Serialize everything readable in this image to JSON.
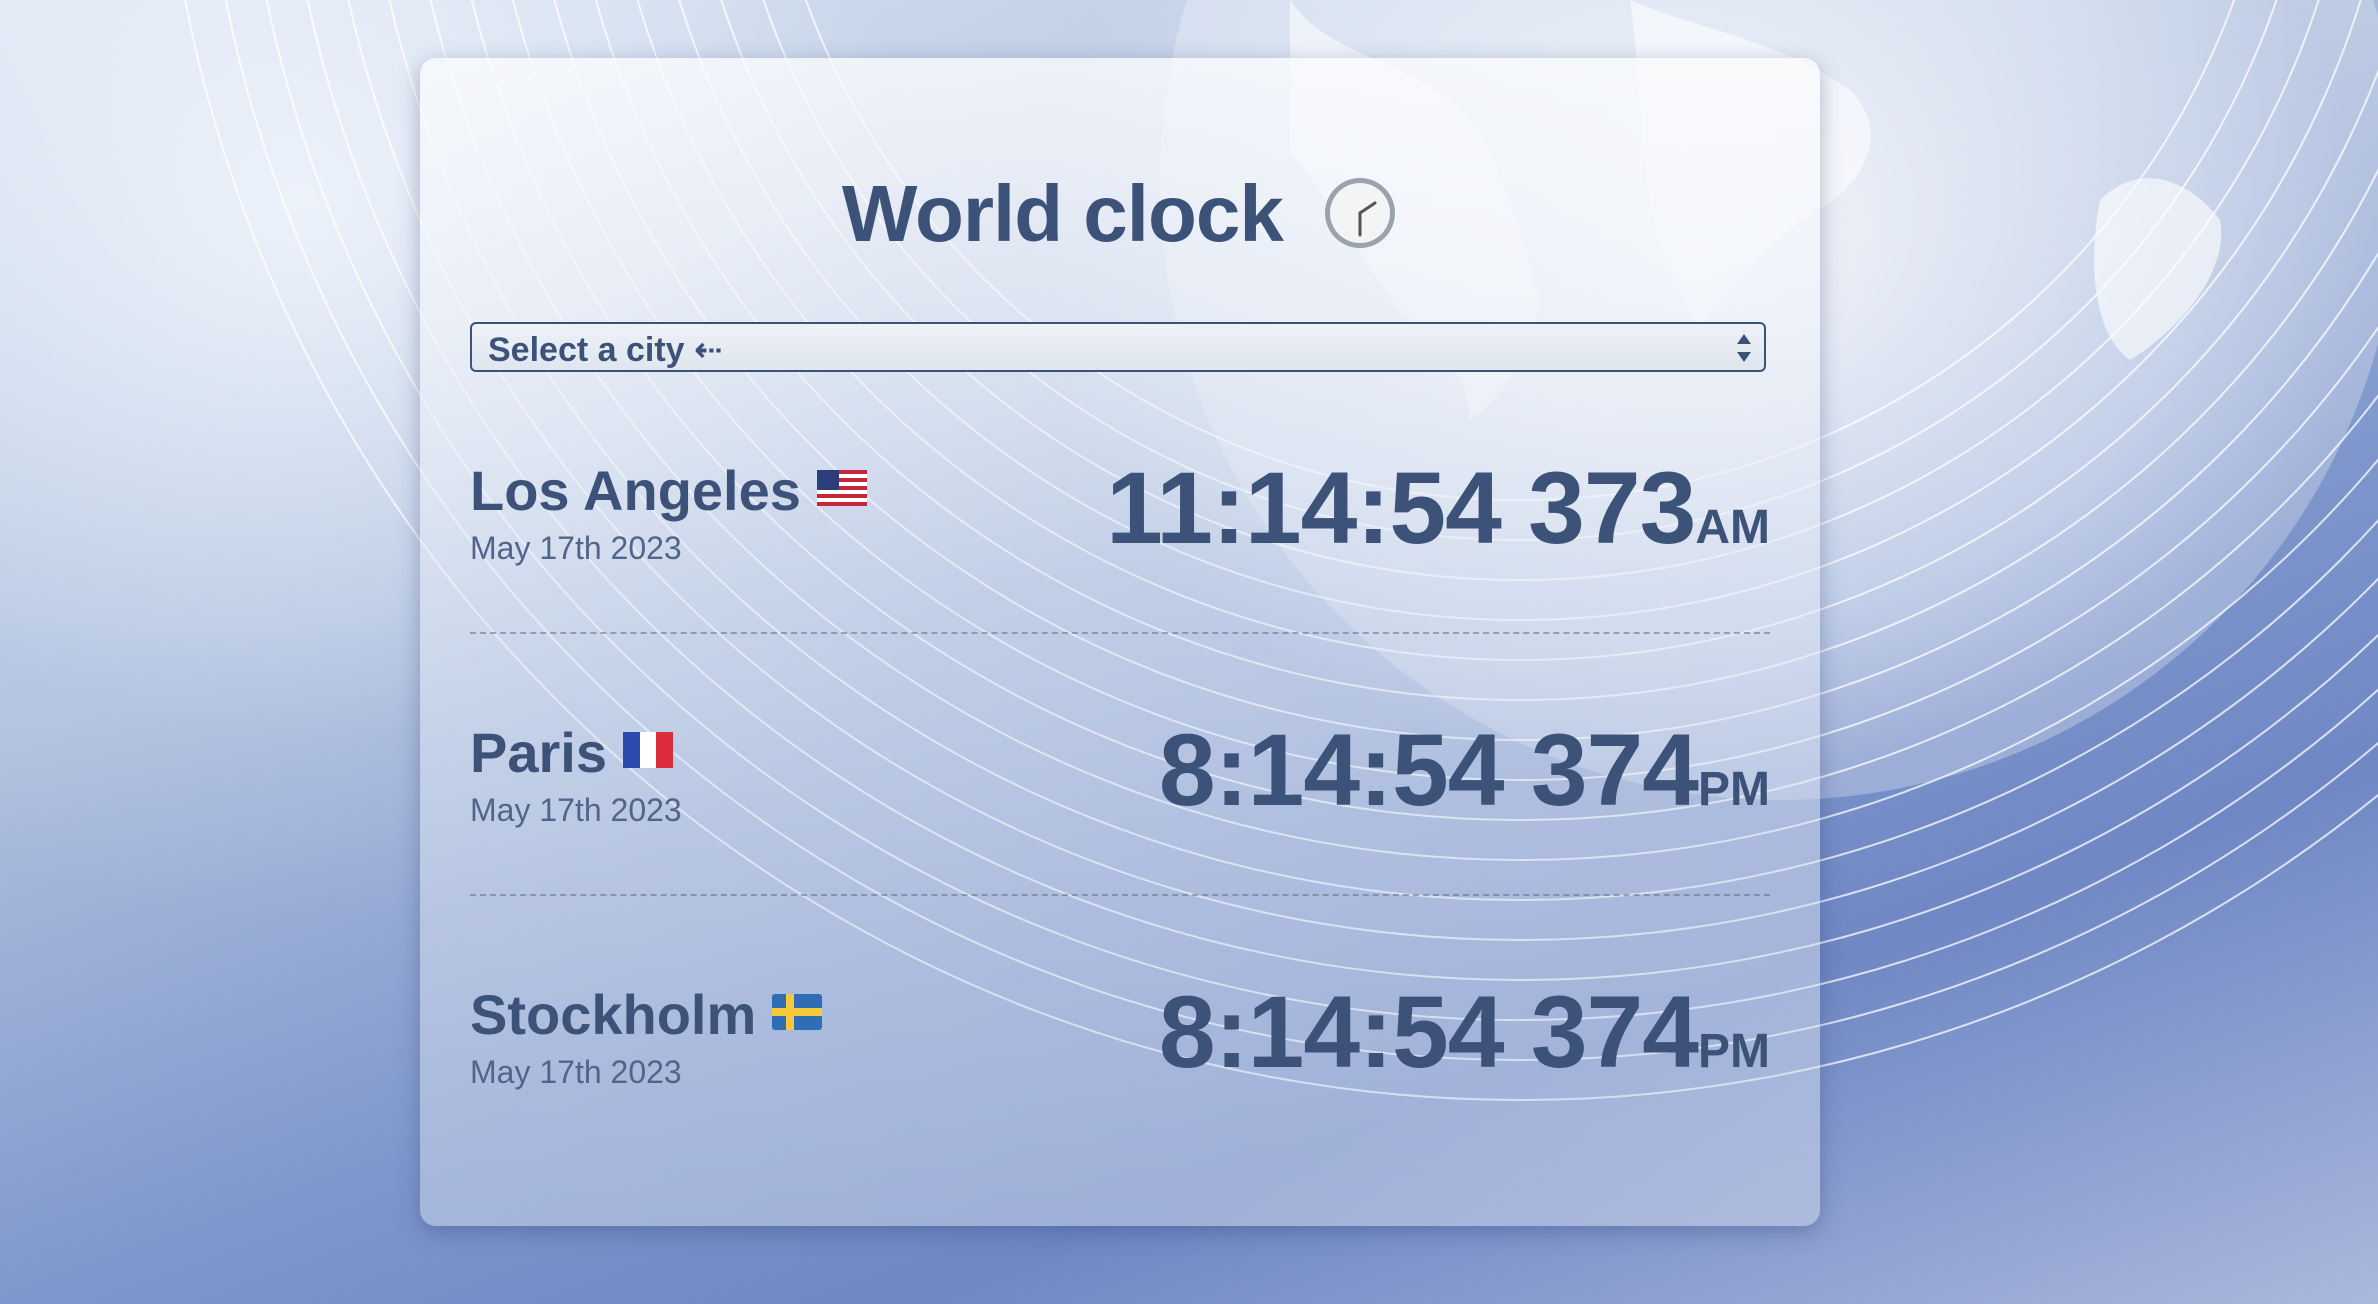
{
  "app": {
    "title": "World clock",
    "title_icon": "clock-icon"
  },
  "city_select": {
    "selected": "Select a city ⇠"
  },
  "clocks": [
    {
      "city": "Los Angeles",
      "flag": "us-flag-icon",
      "date": "May 17th 2023",
      "time": "11:14:54 373",
      "period": "AM"
    },
    {
      "city": "Paris",
      "flag": "france-flag-icon",
      "date": "May 17th 2023",
      "time": "8:14:54 374",
      "period": "PM"
    },
    {
      "city": "Stockholm",
      "flag": "sweden-flag-icon",
      "date": "May 17th 2023",
      "time": "8:14:54 374",
      "period": "PM"
    }
  ],
  "colors": {
    "text": "#3d5279",
    "date_text": "#51658a",
    "background": "#aebfdd"
  }
}
